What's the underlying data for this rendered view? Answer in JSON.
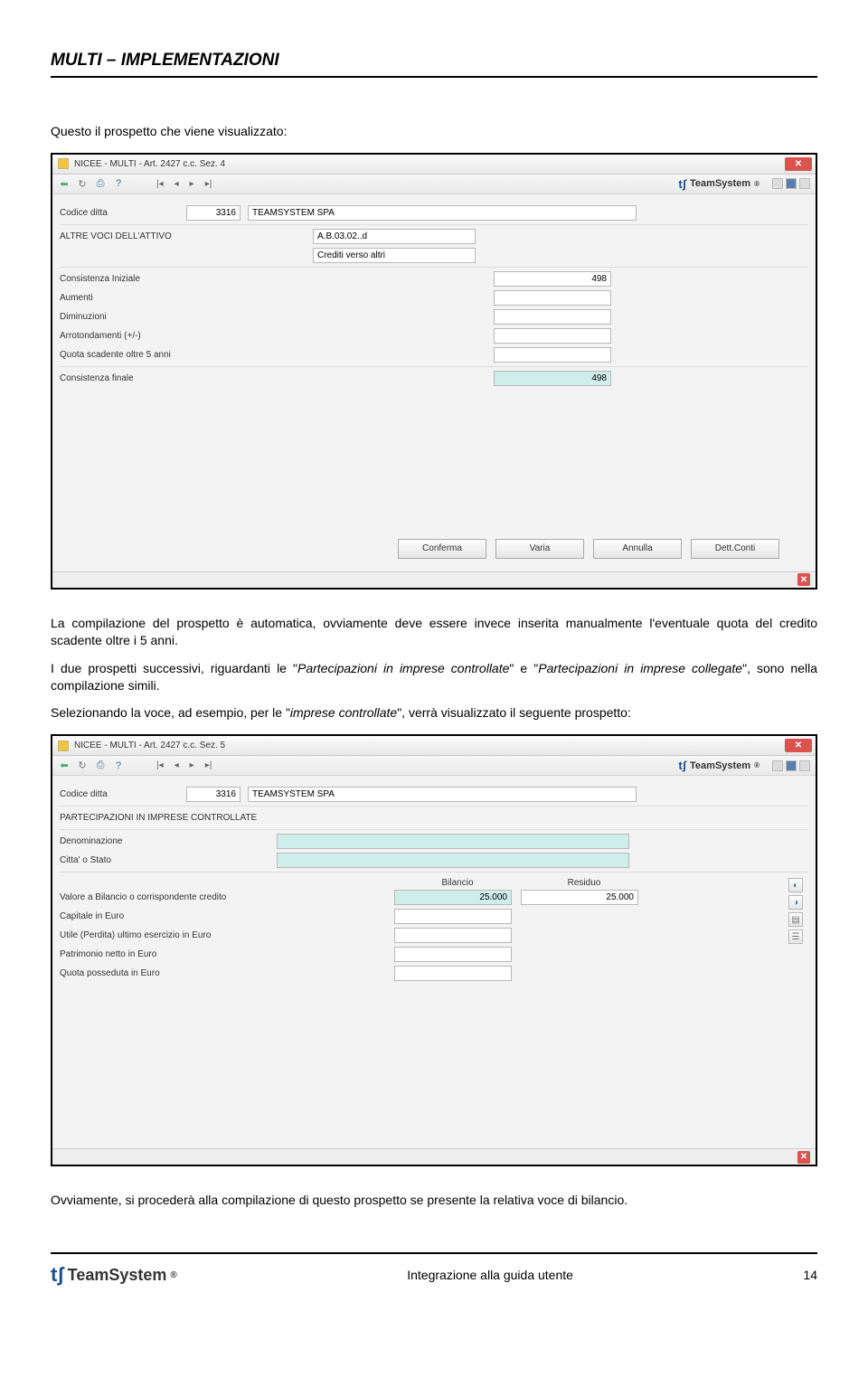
{
  "doc_header": "MULTI – IMPLEMENTAZIONI",
  "intro_text": "Questo il prospetto che viene visualizzato:",
  "para2_a": "La compilazione del prospetto è automatica, ovviamente deve essere invece inserita manualmente l'eventuale quota del credito scadente oltre i 5 anni.",
  "para2_b_prefix": "I due prospetti successivi, riguardanti le \"",
  "para2_b_it1": "Partecipazioni in imprese controllate",
  "para2_b_mid": "\" e \"",
  "para2_b_it2": "Partecipazioni in imprese collegate",
  "para2_b_suffix": "\", sono nella compilazione simili.",
  "para3_prefix": "Selezionando la voce, ad esempio, per le \"",
  "para3_it": "imprese controllate",
  "para3_suffix": "\", verrà visualizzato il seguente prospetto:",
  "para4": "Ovviamente, si procederà alla compilazione di questo prospetto se presente la relativa voce di bilancio.",
  "win1": {
    "title": "NICEE - MULTI - Art. 2427 c.c. Sez. 4",
    "brand": "TeamSystem",
    "codice_ditta_lbl": "Codice ditta",
    "codice_ditta_val": "3316",
    "ditta_nome": "TEAMSYSTEM SPA",
    "section": "ALTRE VOCI DELL'ATTIVO",
    "codice_voce": "A.B.03.02..d",
    "desc_voce": "Crediti verso altri",
    "rows": [
      "Consistenza Iniziale",
      "Aumenti",
      "Diminuzioni",
      "Arrotondamenti (+/-)",
      "Quota scadente oltre 5 anni"
    ],
    "row_vals": [
      "498",
      "",
      "",
      "",
      ""
    ],
    "finale_lbl": "Consistenza finale",
    "finale_val": "498",
    "buttons": [
      "Conferma",
      "Varia",
      "Annulla",
      "Dett.Conti"
    ]
  },
  "win2": {
    "title": "NICEE - MULTI - Art. 2427 c.c. Sez. 5",
    "brand": "TeamSystem",
    "codice_ditta_lbl": "Codice ditta",
    "codice_ditta_val": "3316",
    "ditta_nome": "TEAMSYSTEM SPA",
    "section": "PARTECIPAZIONI IN IMPRESE CONTROLLATE",
    "denom_lbl": "Denominazione",
    "citta_lbl": "Citta' o Stato",
    "col_bilancio": "Bilancio",
    "col_residuo": "Residuo",
    "rows": [
      {
        "label": "Valore a Bilancio o corrispondente credito",
        "bil": "25.000",
        "res": "25.000"
      },
      {
        "label": "Capitale in Euro",
        "bil": "",
        "res": ""
      },
      {
        "label": "Utile (Perdita) ultimo esercizio in Euro",
        "bil": "",
        "res": ""
      },
      {
        "label": "Patrimonio netto in Euro",
        "bil": "",
        "res": ""
      },
      {
        "label": "Quota posseduta in Euro",
        "bil": "",
        "res": ""
      }
    ]
  },
  "footer_brand": "TeamSystem",
  "footer_center": "Integrazione alla guida utente",
  "footer_page": "14"
}
